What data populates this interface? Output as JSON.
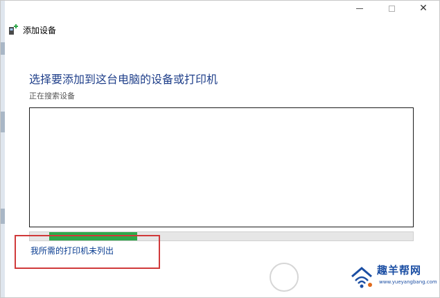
{
  "window": {
    "title": "添加设备",
    "controls": {
      "minimize": "minimize",
      "maximize": "maximize",
      "close": "close"
    }
  },
  "main": {
    "heading": "选择要添加到这台电脑的设备或打印机",
    "status": "正在搜索设备",
    "device_list": [],
    "progress": {
      "state": "indeterminate",
      "fill_start_fraction": 0.05,
      "fill_end_fraction": 0.28,
      "color": "#2ea84a"
    },
    "printer_not_listed_link": "我所需的打印机未列出"
  },
  "annotation": {
    "highlight_color": "#d0393a"
  },
  "watermark": {
    "site_name": "趣羊帮网",
    "site_url": "www.yueyangbang.com",
    "color": "#1b4ea3"
  },
  "icons": {
    "app_icon": "add-device-icon",
    "close": "close-icon",
    "minimize": "minimize-icon",
    "maximize": "maximize-icon"
  }
}
